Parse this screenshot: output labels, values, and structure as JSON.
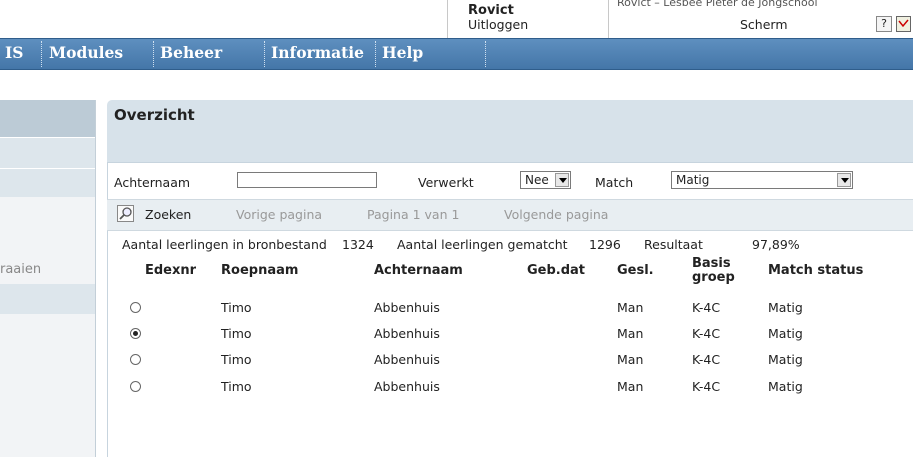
{
  "header": {
    "user_name": "Rovict",
    "logout": "Uitloggen",
    "school_strip": "Rovict – Lesbee Pieter de Jongschool",
    "scherm": "Scherm",
    "help": "?"
  },
  "nav": {
    "items": [
      "IS",
      "Modules",
      "Beheer",
      "Informatie",
      "Help"
    ]
  },
  "sidebar": {
    "link_partial": "raaien"
  },
  "main": {
    "title": "Overzicht",
    "filters": {
      "achternaam_label": "Achternaam",
      "achternaam_value": "",
      "verwerkt_label": "Verwerkt",
      "verwerkt_value": "Nee",
      "match_label": "Match",
      "match_value": "Matig"
    },
    "toolbar": {
      "search": "Zoeken",
      "prev": "Vorige pagina",
      "page": "Pagina 1 van 1",
      "next": "Volgende pagina"
    },
    "stats": {
      "bron_label": "Aantal leerlingen in bronbestand",
      "bron_value": "1324",
      "gematcht_label": "Aantal leerlingen gematcht",
      "gematcht_value": "1296",
      "resultaat_label": "Resultaat",
      "resultaat_value": "97,89%"
    },
    "table": {
      "columns": [
        "Edexnr",
        "Roepnaam",
        "Achternaam",
        "Geb.dat",
        "Gesl.",
        "Basis",
        "groep",
        "Match status"
      ],
      "rows": [
        {
          "selected": false,
          "edexnr": "",
          "roepnaam": "Timo",
          "achternaam": "Abbenhuis",
          "gebdat": "",
          "gesl": "Man",
          "groep": "K-4C",
          "status": "Matig"
        },
        {
          "selected": true,
          "edexnr": "",
          "roepnaam": "Timo",
          "achternaam": "Abbenhuis",
          "gebdat": "",
          "gesl": "Man",
          "groep": "K-4C",
          "status": "Matig"
        },
        {
          "selected": false,
          "edexnr": "",
          "roepnaam": "Timo",
          "achternaam": "Abbenhuis",
          "gebdat": "",
          "gesl": "Man",
          "groep": "K-4C",
          "status": "Matig"
        },
        {
          "selected": false,
          "edexnr": "",
          "roepnaam": "Timo",
          "achternaam": "Abbenhuis",
          "gebdat": "",
          "gesl": "Man",
          "groep": "K-4C",
          "status": "Matig"
        }
      ]
    }
  }
}
